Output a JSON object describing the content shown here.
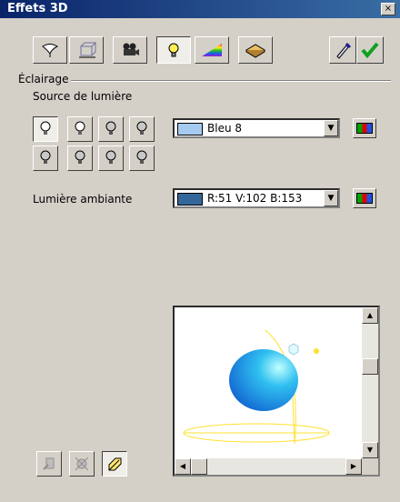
{
  "window": {
    "title": "Effets 3D",
    "close_glyph": "×"
  },
  "toolbar": {
    "buttons": [
      {
        "name": "geometry-icon"
      },
      {
        "name": "shading-icon"
      },
      {
        "name": "camera-icon"
      },
      {
        "name": "lighting-icon",
        "selected": true
      },
      {
        "name": "texture-icon"
      },
      {
        "name": "material-icon"
      }
    ],
    "eyedropper_icon": "eyedropper-icon",
    "assign_icon": "checkmark-icon"
  },
  "lighting": {
    "section_label": "Éclairage",
    "source_label": "Source de lumière",
    "light_sources": [
      {
        "index": 1,
        "on": true,
        "selected": true
      },
      {
        "index": 2,
        "on": true
      },
      {
        "index": 3,
        "on": false
      },
      {
        "index": 4,
        "on": false
      },
      {
        "index": 5,
        "on": false
      },
      {
        "index": 6,
        "on": false
      },
      {
        "index": 7,
        "on": false
      },
      {
        "index": 8,
        "on": false
      }
    ],
    "source_color": {
      "value": "Bleu 8",
      "swatch": "#a6caf0"
    },
    "ambient_label": "Lumière ambiante",
    "ambient_color": {
      "value": "R:51 V:102 B:153",
      "swatch": "#336699"
    }
  },
  "preview": {
    "sphere_color": "#2a9fe8",
    "light_line_color": "#ffee33"
  },
  "colors": {
    "face": "#d4d0c8",
    "title_start": "#0a246a",
    "title_end": "#3a6ea5"
  }
}
